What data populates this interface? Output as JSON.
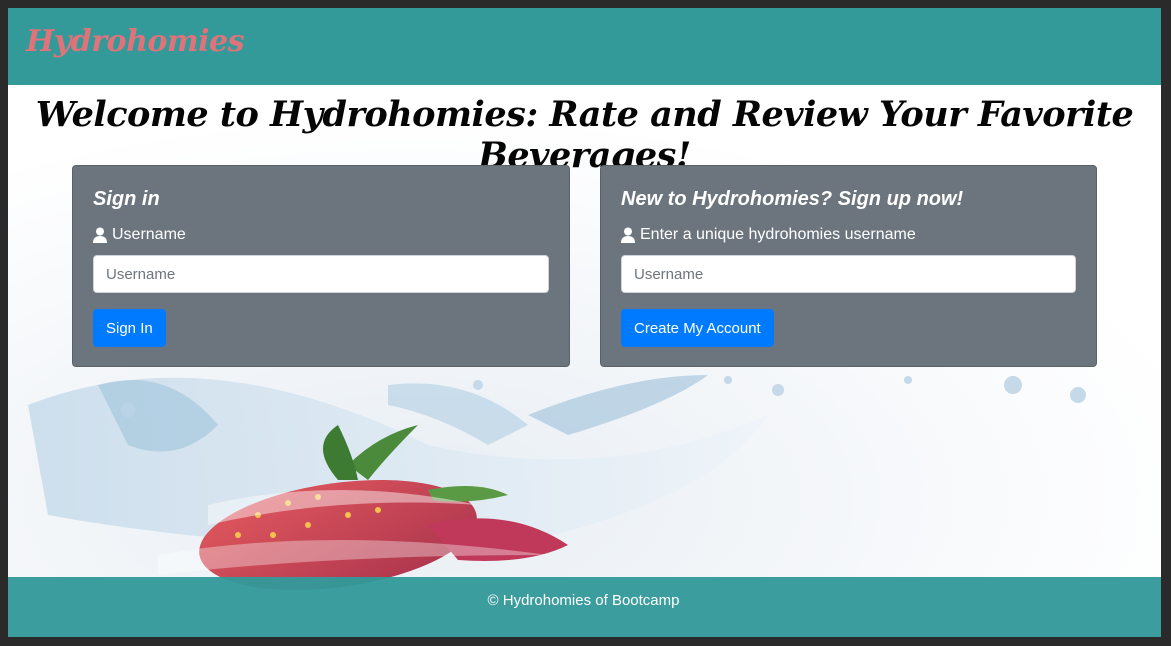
{
  "navbar": {
    "brand": "Hydrohomies"
  },
  "headline": "Welcome to Hydrohomies: Rate and Review Your Favorite Beverages!",
  "signin": {
    "title": "Sign in",
    "label": "Username",
    "placeholder": "Username",
    "button": "Sign In"
  },
  "signup": {
    "title": "New to Hydrohomies? Sign up now!",
    "label": "Enter a unique hydrohomies username",
    "placeholder": "Username",
    "button": "Create My Account"
  },
  "footer": {
    "text": "© Hydrohomies of Bootcamp"
  },
  "colors": {
    "navbar": "#339999",
    "brand": "#e0737a",
    "card": "#6c757d",
    "button": "#007bff"
  },
  "icons": {
    "user": "user-icon"
  }
}
